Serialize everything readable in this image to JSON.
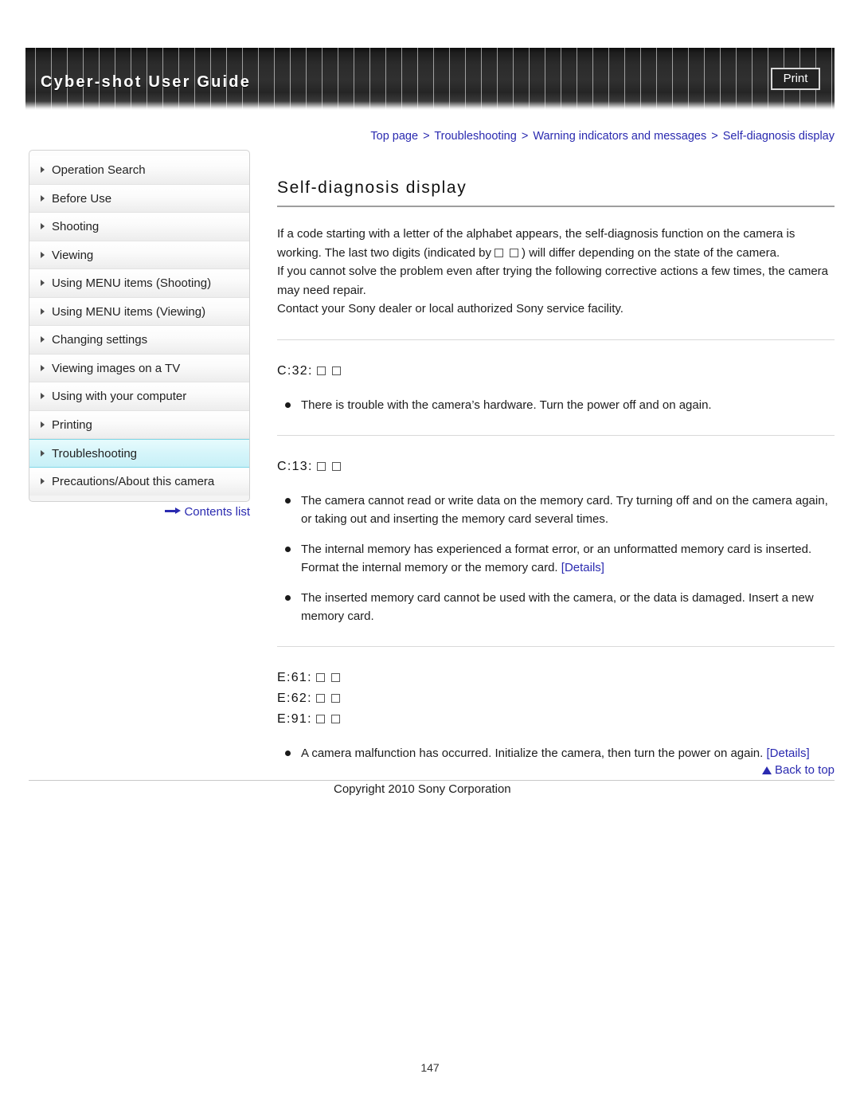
{
  "header": {
    "title": "Cyber-shot User Guide",
    "print_label": "Print"
  },
  "breadcrumb": {
    "items": [
      "Top page",
      "Troubleshooting",
      "Warning indicators and messages",
      "Self-diagnosis display"
    ],
    "separator": ">"
  },
  "sidebar": {
    "items": [
      {
        "label": "Operation Search",
        "active": false
      },
      {
        "label": "Before Use",
        "active": false
      },
      {
        "label": "Shooting",
        "active": false
      },
      {
        "label": "Viewing",
        "active": false
      },
      {
        "label": "Using MENU items (Shooting)",
        "active": false
      },
      {
        "label": "Using MENU items (Viewing)",
        "active": false
      },
      {
        "label": "Changing settings",
        "active": false
      },
      {
        "label": "Viewing images on a TV",
        "active": false
      },
      {
        "label": "Using with your computer",
        "active": false
      },
      {
        "label": "Printing",
        "active": false
      },
      {
        "label": "Troubleshooting",
        "active": true
      },
      {
        "label": "Precautions/About this camera",
        "active": false
      }
    ],
    "contents_link": "Contents list"
  },
  "main": {
    "title": "Self-diagnosis display",
    "intro": {
      "line1_a": "If a code starting with a letter of the alphabet appears, the self-diagnosis function on the camera is working. The last two digits (indicated by",
      "line1_b": ") will differ depending on the state of the camera.",
      "line2": "If you cannot solve the problem even after trying the following corrective actions a few times, the camera may need repair.",
      "line3": "Contact your Sony dealer or local authorized Sony service facility."
    },
    "sections": [
      {
        "code": "C:32:",
        "bullets": [
          {
            "text": "There is trouble with the camera’s hardware. Turn the power off and on again.",
            "link": null
          }
        ]
      },
      {
        "code": "C:13:",
        "bullets": [
          {
            "text": "The camera cannot read or write data on the memory card. Try turning off and on the camera again, or taking out and inserting the memory card several times.",
            "link": null
          },
          {
            "text": "The internal memory has experienced a format error, or an unformatted memory card is inserted. Format the internal memory or the memory card.",
            "link": "[Details]"
          },
          {
            "text": "The inserted memory card cannot be used with the camera, or the data is damaged. Insert a new memory card.",
            "link": null
          }
        ]
      },
      {
        "code_lines": [
          "E:61:",
          "E:62:",
          "E:91:"
        ],
        "bullets": [
          {
            "text": "A camera malfunction has occurred. Initialize the camera, then turn the power on again.",
            "link": "[Details]"
          }
        ]
      }
    ]
  },
  "footer": {
    "back_to_top": "Back to top",
    "copyright": "Copyright 2010 Sony Corporation",
    "page_number": "147"
  },
  "colors": {
    "link": "#2a2ab0",
    "active_nav_bg": "#d5f5fa",
    "active_nav_border": "#7fd6e6",
    "title_rule": "#9e9e9e"
  }
}
